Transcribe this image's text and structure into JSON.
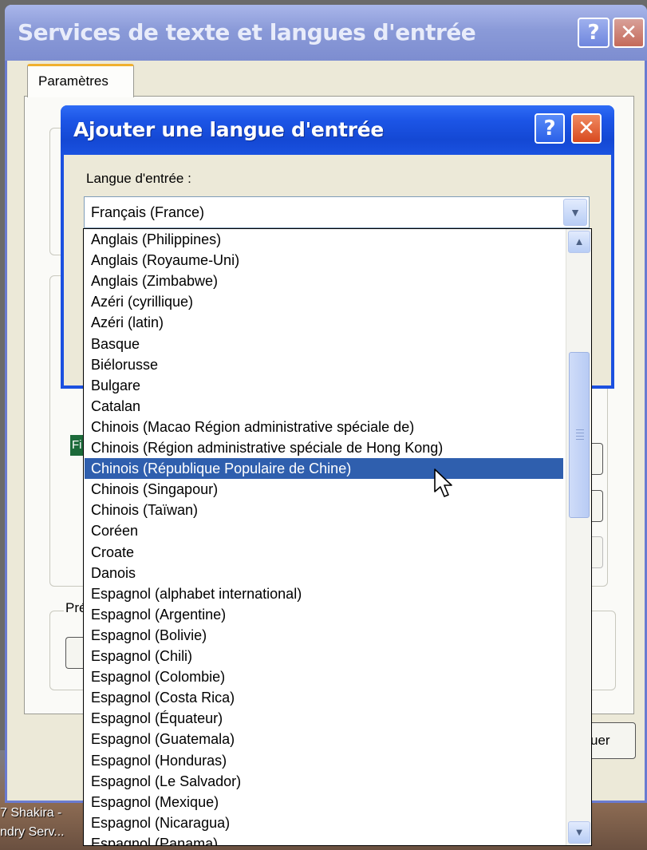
{
  "outer_window": {
    "title": "Services de texte et langues d'entrée",
    "help_glyph": "?",
    "close_glyph": "✕",
    "tab_label": "Paramètres",
    "preferences_fragment": "Pré",
    "button_fragment": "uer"
  },
  "dialog": {
    "title": "Ajouter une langue d'entrée",
    "help_glyph": "?",
    "close_glyph": "✕",
    "field_label": "Langue d'entrée :",
    "combo_value": "Français (France)",
    "combo_arrow": "▼",
    "hidden_row_fragment": "Fi"
  },
  "language_list": {
    "items": [
      "Anglais (Philippines)",
      "Anglais (Royaume-Uni)",
      "Anglais (Zimbabwe)",
      "Azéri (cyrillique)",
      "Azéri (latin)",
      "Basque",
      "Biélorusse",
      "Bulgare",
      "Catalan",
      "Chinois (Macao Région administrative spéciale de)",
      "Chinois (Région administrative spéciale de Hong Kong)",
      "Chinois (République Populaire de Chine)",
      "Chinois (Singapour)",
      "Chinois (Taïwan)",
      "Coréen",
      "Croate",
      "Danois",
      "Espagnol (alphabet international)",
      "Espagnol (Argentine)",
      "Espagnol (Bolivie)",
      "Espagnol (Chili)",
      "Espagnol (Colombie)",
      "Espagnol (Costa Rica)",
      "Espagnol (Équateur)",
      "Espagnol (Guatemala)",
      "Espagnol (Honduras)",
      "Espagnol (Le Salvador)",
      "Espagnol (Mexique)",
      "Espagnol (Nicaragua)",
      "Espagnol (Panama)"
    ],
    "selected": "Chinois (République Populaire de Chine)",
    "scroll_up": "▲",
    "scroll_down": "▼"
  },
  "desktop": {
    "label_line1": "7 Shakira -",
    "label_line2": "ndry Serv..."
  },
  "colors": {
    "dialog_title_bar": "#1c55e6",
    "selection": "#2f5fae",
    "window_face": "#ece9d8"
  }
}
